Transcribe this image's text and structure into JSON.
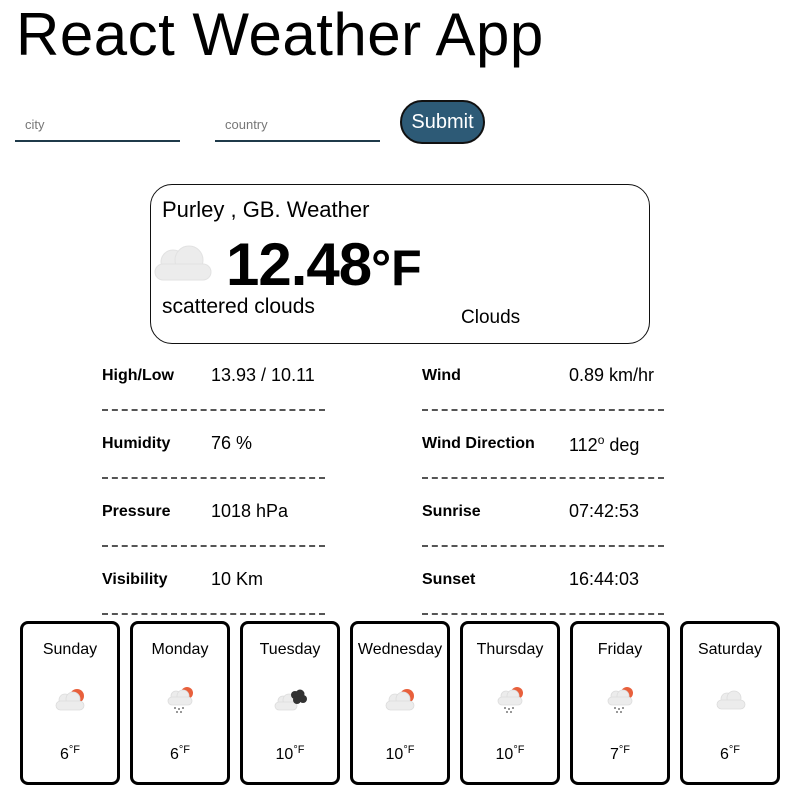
{
  "app": {
    "title": "React Weather App"
  },
  "search": {
    "city_placeholder": "city",
    "country_placeholder": "country",
    "submit_label": "Submit"
  },
  "current": {
    "location": "Purley , GB. Weather",
    "temp": "12.48",
    "unit": "°F",
    "description": "scattered clouds",
    "main": "Clouds",
    "icon": "cloud-icon"
  },
  "stats": {
    "left": [
      {
        "label": "High/Low",
        "value": "13.93 / 10.11"
      },
      {
        "label": "Humidity",
        "value": "76 %"
      },
      {
        "label": "Pressure",
        "value": "1018 hPa"
      },
      {
        "label": "Visibility",
        "value": "10 Km"
      }
    ],
    "right": [
      {
        "label": "Wind",
        "value": "0.89 km/hr"
      },
      {
        "label": "Wind Direction",
        "value_pre": "112",
        "value_sup": "o",
        "value_post": " deg"
      },
      {
        "label": "Sunrise",
        "value": "07:42:53"
      },
      {
        "label": "Sunset",
        "value": "16:44:03"
      }
    ]
  },
  "forecast": [
    {
      "day": "Sunday",
      "temp": "6",
      "unit": "°F",
      "icon": "partly-cloudy-icon"
    },
    {
      "day": "Monday",
      "temp": "6",
      "unit": "°F",
      "icon": "rain-cloud-sun-icon"
    },
    {
      "day": "Tuesday",
      "temp": "10",
      "unit": "°F",
      "icon": "dark-clouds-icon"
    },
    {
      "day": "Wednesday",
      "temp": "10",
      "unit": "°F",
      "icon": "partly-cloudy-icon"
    },
    {
      "day": "Thursday",
      "temp": "10",
      "unit": "°F",
      "icon": "rain-cloud-sun-icon"
    },
    {
      "day": "Friday",
      "temp": "7",
      "unit": "°F",
      "icon": "rain-cloud-sun-icon"
    },
    {
      "day": "Saturday",
      "temp": "6",
      "unit": "°F",
      "icon": "cloud-icon"
    }
  ],
  "colors": {
    "submit_bg": "#2d5a76",
    "sun": "#e8603c",
    "cloud": "#ececec",
    "dark_cloud": "#333333",
    "rain": "#777777"
  }
}
